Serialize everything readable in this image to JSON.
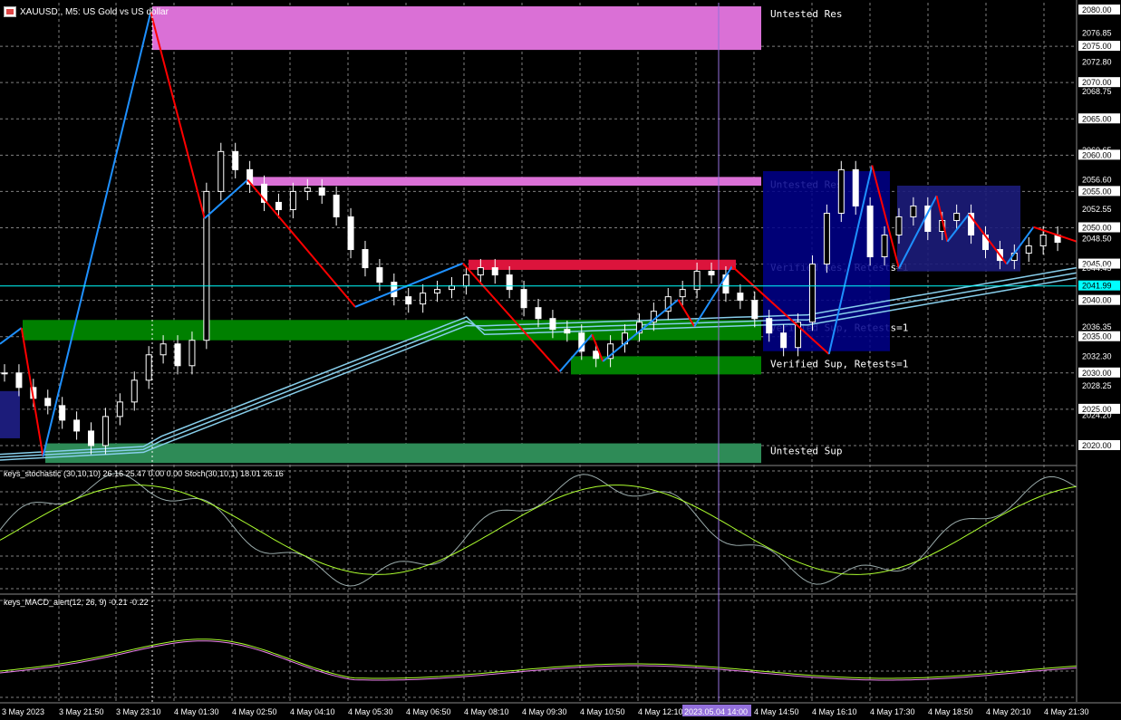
{
  "window": {
    "symbol_title": "XAUUSD., M5:  US Gold vs US dollar"
  },
  "indicators": {
    "stoch_title": "keys_stochastic (30,10,10) 26.16 25.47 0.00 0.00 Stoch(30,10,1) 18.01 26.16",
    "macd_title": "keys_MACD_alert(12, 26, 9) -0.21 -0.22"
  },
  "colors": {
    "resistance_zone": "#da70d6",
    "support_zone": "#008000",
    "untested_sup": "#2e8b57",
    "verified_res": "#dc143c",
    "highlight_box": "#00008b",
    "zigzag_up": "#1e90ff",
    "zigzag_down": "#ff0000",
    "ma_lines": "#87ceeb",
    "grid": "#808080",
    "current_price": "#00ffff",
    "vertical_marker": "#9370db"
  },
  "chart_data": {
    "type": "line",
    "ylim": [
      2017.5,
      2081.0
    ],
    "price_ticks": [
      "2080.00",
      "2076.85",
      "2075.00",
      "2072.80",
      "2070.00",
      "2068.75",
      "2065.00",
      "2060.65",
      "2060.00",
      "2056.60",
      "2055.00",
      "2052.55",
      "2050.00",
      "2048.50",
      "2045.00",
      "2044.45",
      "2041.99",
      "2040.00",
      "2036.35",
      "2035.00",
      "2032.30",
      "2030.00",
      "2028.25",
      "2025.00",
      "2024.20",
      "2020.00"
    ],
    "time_labels": [
      "3 May 2023",
      "3 May 21:50",
      "3 May 23:10",
      "4 May 01:30",
      "4 May 02:50",
      "4 May 04:10",
      "4 May 05:30",
      "4 May 06:50",
      "4 May 08:10",
      "4 May 09:30",
      "4 May 10:50",
      "4 May 12:10",
      "2023.05.04 14:00",
      "4 May 14:50",
      "4 May 16:10",
      "4 May 17:30",
      "4 May 18:50",
      "4 May 20:10",
      "4 May 21:30"
    ],
    "current_price": "2041.99",
    "zones": [
      {
        "label": "Untested Res",
        "top": 2080.5,
        "bottom": 2074.5,
        "kind": "res"
      },
      {
        "label": "Untested Res",
        "top": 2057.0,
        "bottom": 2055.8,
        "kind": "res"
      },
      {
        "label": "Verified Res, Retests=1",
        "top": 2045.6,
        "bottom": 2044.2,
        "kind": "vres"
      },
      {
        "label": "Verified Sup, Retests=1",
        "top": 2037.3,
        "bottom": 2034.5,
        "kind": "sup"
      },
      {
        "label": "Verified Sup, Retests=1",
        "top": 2032.3,
        "bottom": 2029.8,
        "kind": "sup"
      },
      {
        "label": "Untested Sup",
        "top": 2020.3,
        "bottom": 2017.6,
        "kind": "usup"
      }
    ],
    "zigzag": [
      [
        0,
        2034.0
      ],
      [
        0.02,
        2036.2
      ],
      [
        0.04,
        2018.5
      ],
      [
        0.14,
        2079.7
      ],
      [
        0.19,
        2051.3
      ],
      [
        0.23,
        2056.6
      ],
      [
        0.33,
        2039.1
      ],
      [
        0.43,
        2045.1
      ],
      [
        0.52,
        2030.2
      ],
      [
        0.55,
        2035.3
      ],
      [
        0.56,
        2031.6
      ],
      [
        0.63,
        2040.1
      ],
      [
        0.645,
        2036.4
      ],
      [
        0.68,
        2044.7
      ],
      [
        0.77,
        2032.6
      ],
      [
        0.81,
        2058.6
      ],
      [
        0.835,
        2044.4
      ],
      [
        0.87,
        2054.4
      ],
      [
        0.88,
        2048.1
      ],
      [
        0.9,
        2051.9
      ],
      [
        0.935,
        2045.0
      ],
      [
        0.96,
        2050.1
      ],
      [
        1.0,
        2048.1
      ]
    ],
    "close": [
      2030.0,
      2028.0,
      2026.5,
      2025.5,
      2023.5,
      2022.0,
      2020.0,
      2024.0,
      2026.0,
      2029.0,
      2032.5,
      2034.0,
      2031.0,
      2034.5,
      2055.0,
      2060.5,
      2058.0,
      2056.0,
      2053.5,
      2052.5,
      2055.0,
      2055.5,
      2054.5,
      2051.5,
      2047.0,
      2044.5,
      2042.5,
      2040.5,
      2039.5,
      2041.0,
      2041.5,
      2042.0,
      2043.5,
      2044.5,
      2043.5,
      2041.5,
      2039.0,
      2037.5,
      2036.0,
      2035.5,
      2033.0,
      2032.0,
      2034.0,
      2035.5,
      2037.0,
      2038.5,
      2040.5,
      2041.5,
      2044.0,
      2043.5,
      2041.0,
      2040.0,
      2037.5,
      2035.5,
      2033.5,
      2037.0,
      2045.0,
      2052.0,
      2058.0,
      2053.0,
      2046.0,
      2049.0,
      2051.5,
      2053.0,
      2049.5,
      2051.0,
      2052.0,
      2049.0,
      2047.0,
      2045.5,
      2046.5,
      2047.5,
      2049.0,
      2048.0
    ]
  }
}
